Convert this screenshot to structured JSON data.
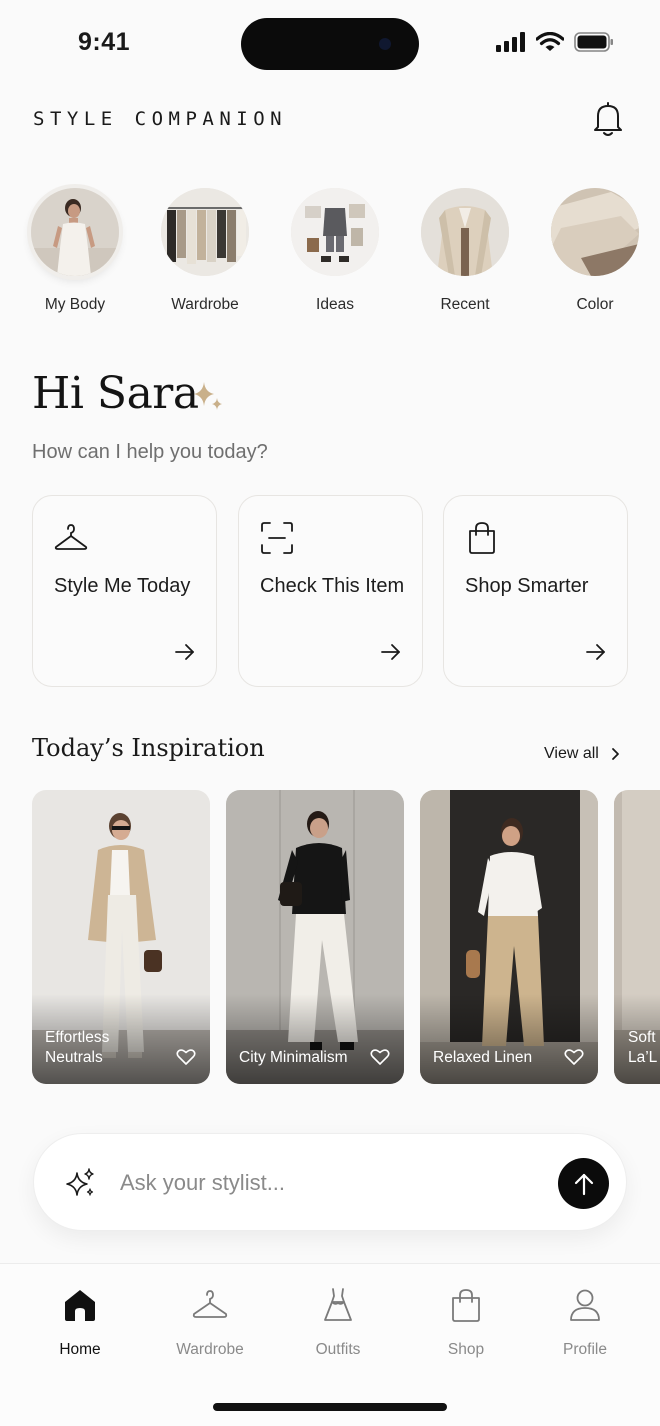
{
  "status": {
    "time": "9:41"
  },
  "header": {
    "title": "STYLE COMPANION",
    "bell_icon": "bell-icon"
  },
  "stories": [
    {
      "label": "My Body"
    },
    {
      "label": "Wardrobe"
    },
    {
      "label": "Ideas"
    },
    {
      "label": "Recent"
    },
    {
      "label": "Color"
    }
  ],
  "greeting": {
    "title": "Hi Sara",
    "subtitle": "How can I help you today?"
  },
  "actions": [
    {
      "label": "Style Me Today",
      "icon": "hanger-icon"
    },
    {
      "label": "Check This Item",
      "icon": "scan-icon"
    },
    {
      "label": "Shop Smarter",
      "icon": "shopping-bag-icon"
    }
  ],
  "inspiration": {
    "title": "Today’s Inspiration",
    "view_all": "View all",
    "cards": [
      {
        "caption": "Effortless Neutrals"
      },
      {
        "caption": "City Minimalism"
      },
      {
        "caption": "Relaxed Linen"
      },
      {
        "caption": "Soft La’L"
      }
    ]
  },
  "ask": {
    "placeholder": "Ask your stylist..."
  },
  "tabbar": {
    "items": [
      {
        "label": "Home",
        "active": true
      },
      {
        "label": "Wardrobe",
        "active": false
      },
      {
        "label": "Outfits",
        "active": false
      },
      {
        "label": "Shop",
        "active": false
      },
      {
        "label": "Profile",
        "active": false
      }
    ]
  },
  "colors": {
    "accent": "#c9b08a",
    "text": "#1a1a1a",
    "muted": "#8a8a8a",
    "background": "#fafafa"
  }
}
